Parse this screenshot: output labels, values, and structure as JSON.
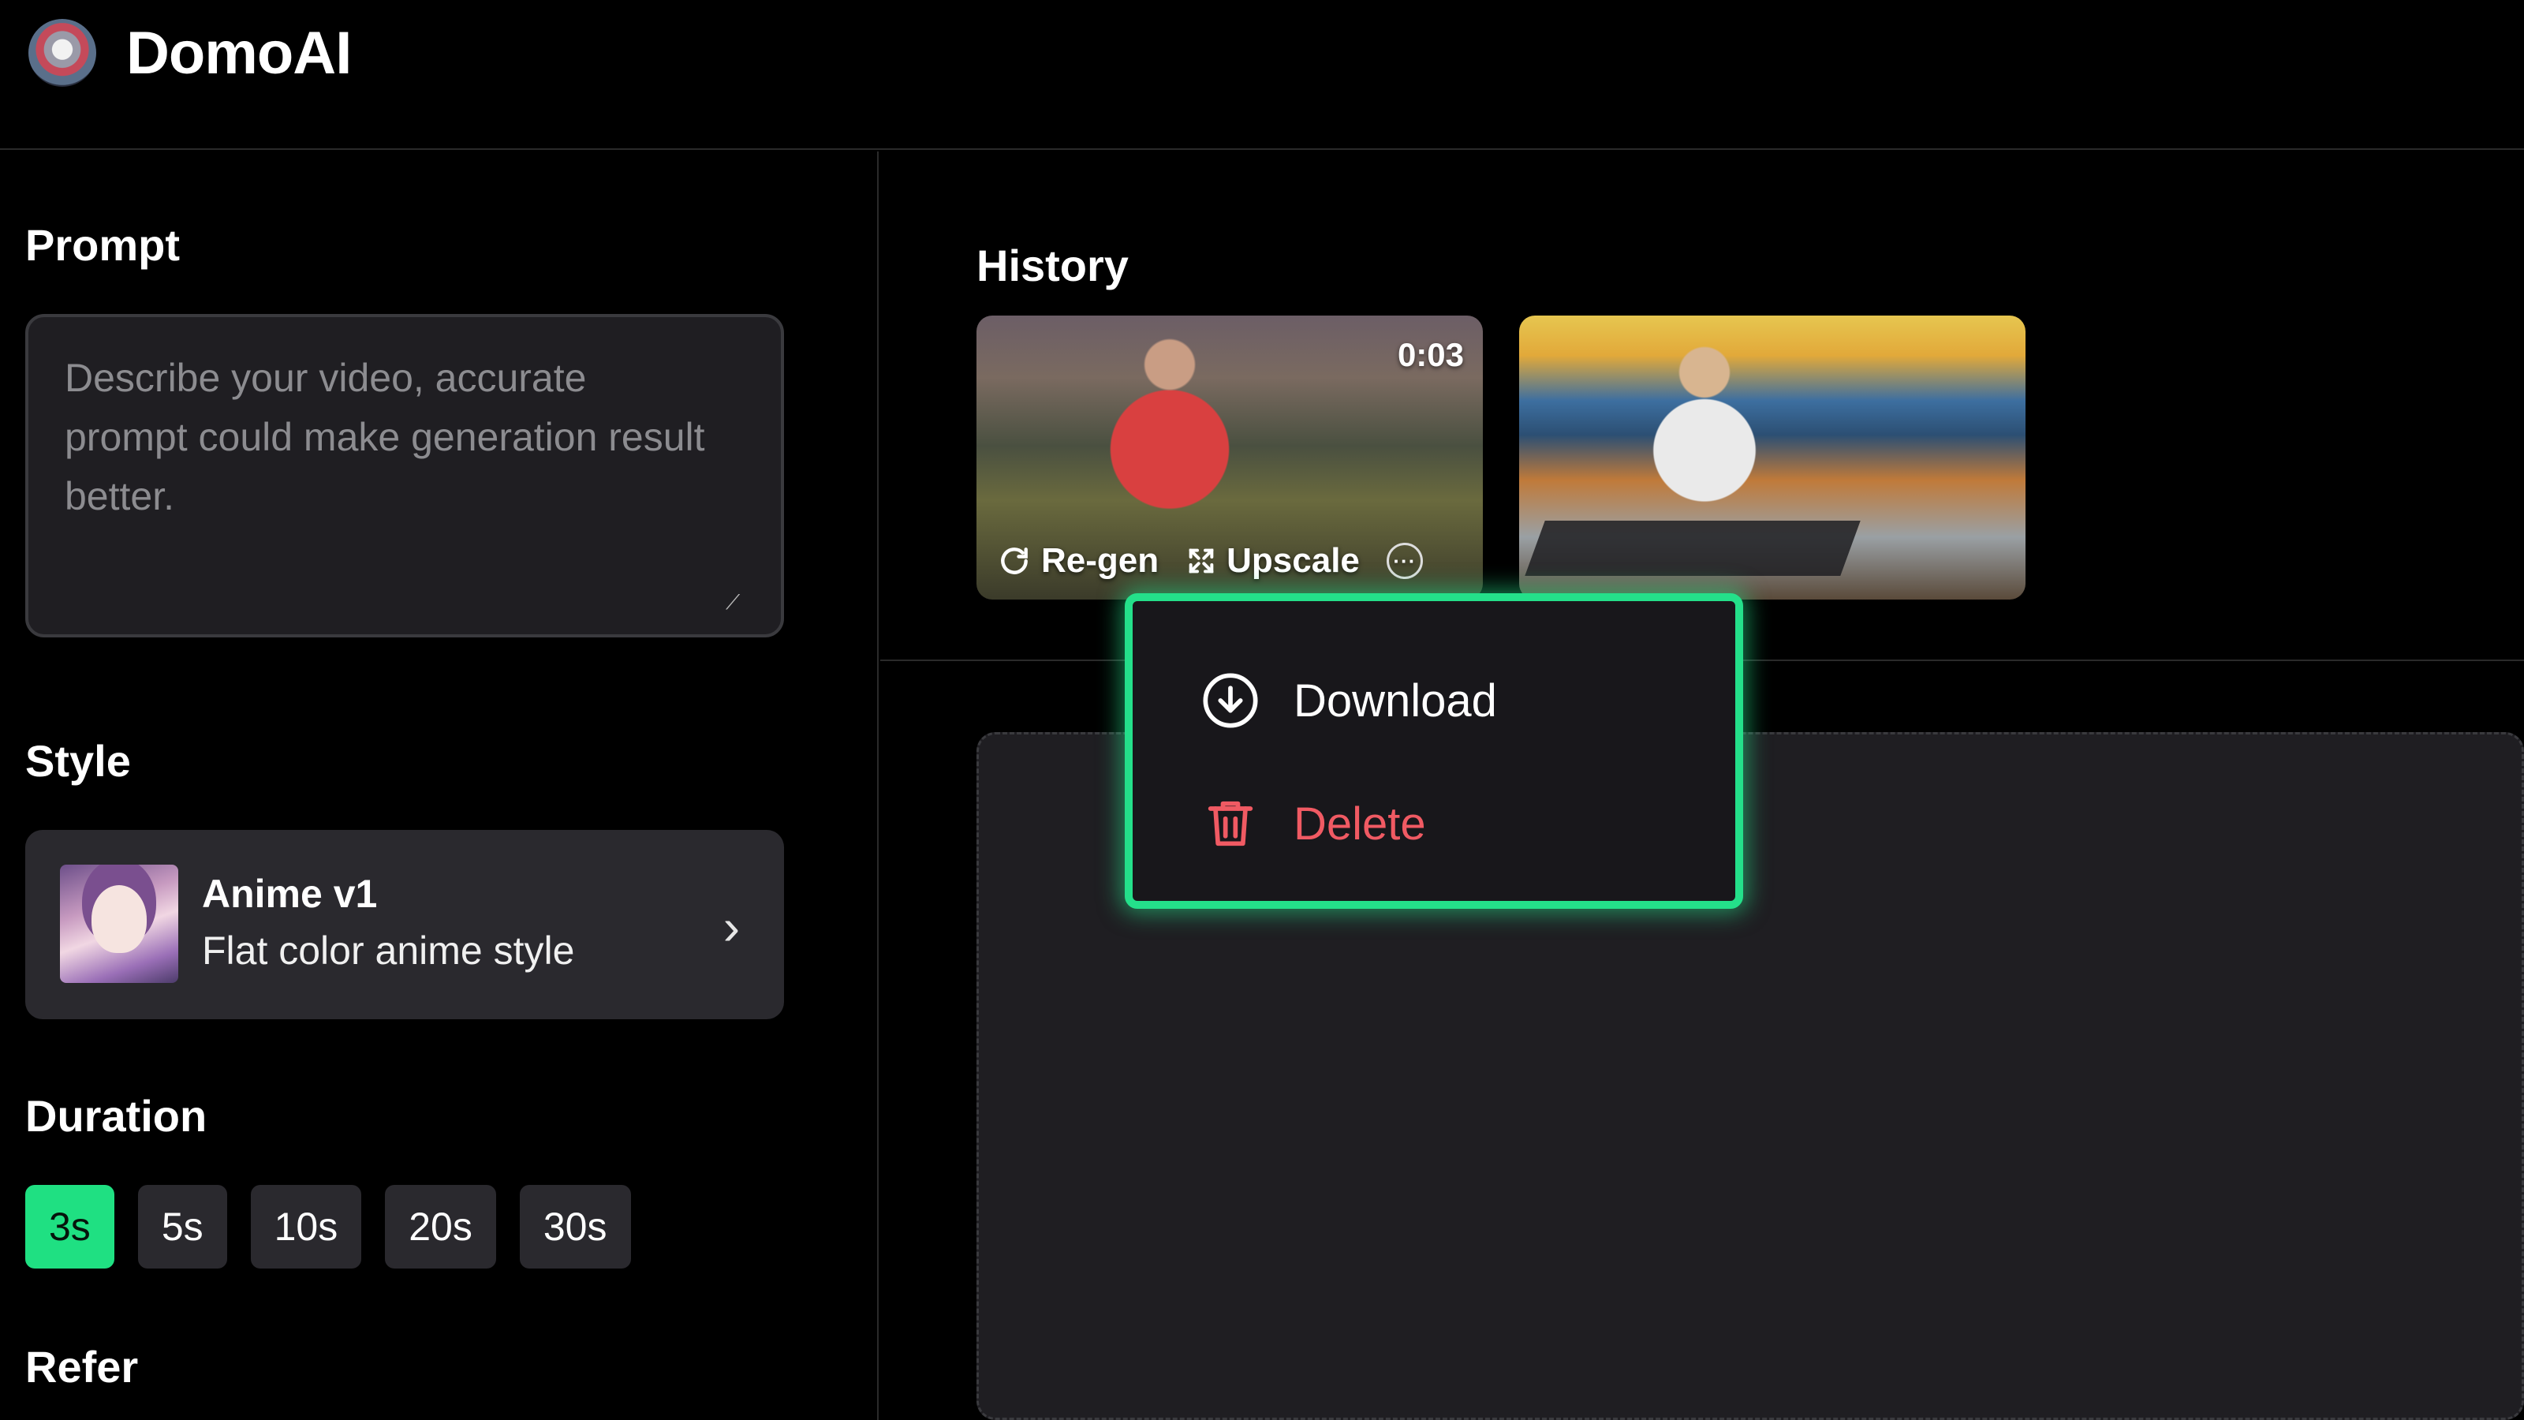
{
  "brand": {
    "name": "DomoAI",
    "logo_icon": "domoai-logo-icon"
  },
  "prompt": {
    "title": "Prompt",
    "placeholder": "Describe your video, accurate prompt could make generation result better."
  },
  "style": {
    "title": "Style",
    "name": "Anime v1",
    "description": "Flat color anime style"
  },
  "duration": {
    "title": "Duration",
    "options": [
      "3s",
      "5s",
      "10s",
      "20s",
      "30s"
    ],
    "selected": "3s"
  },
  "refer": {
    "title": "Refer"
  },
  "history": {
    "title": "History",
    "items": [
      {
        "duration": "0:03",
        "regen_label": "Re-gen",
        "upscale_label": "Upscale"
      },
      {}
    ]
  },
  "context_menu": {
    "download_label": "Download",
    "delete_label": "Delete"
  },
  "colors": {
    "accent": "#1fe082",
    "danger": "#f05a63",
    "background": "#000000",
    "surface": "#2a292e"
  }
}
